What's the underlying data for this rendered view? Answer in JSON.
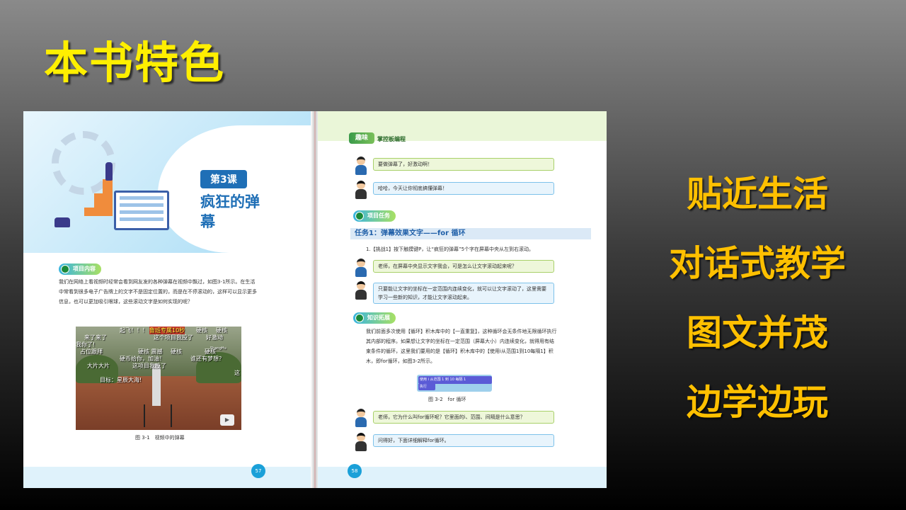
{
  "slide": {
    "title": "本书特色",
    "features": [
      "贴近生活",
      "对话式教学",
      "图文并茂",
      "边学边玩"
    ]
  },
  "left_page": {
    "lesson_badge": "第3课",
    "lesson_title": "疯狂的弹幕",
    "section_tag": "项目内容",
    "paragraph": "我们在网络上看视频时经常会看到网友发的各种弹幕在视频中飘过，如图3-1所示。在生活中常看到很多电子广告牌上的文字不是固定位置的，而是在不停滚动的，这样可以显示更多信息，也可以更加吸引眼球，这些滚动文字是如何实现的呢？",
    "danmaku": [
      "起飞！！！",
      "鲁班专属10秒",
      "硬核",
      "硬核",
      "来了来了",
      "这个项目我投了",
      "好激动",
      "我你了!",
      "占位跟拜",
      "硬核 震撼",
      "硬核",
      "硬核",
      "硬币给你，加油！",
      "谁还有梦想？",
      "大片大片",
      "这项目我投了",
      "目标：星辰大海!",
      "这"
    ],
    "video_watermark": "ShangHu",
    "figure_caption": "图 3-1　视频中的弹幕",
    "page_number": "57"
  },
  "right_page": {
    "header_badge": "趣味",
    "header_text": "掌控板编程",
    "dialog_1": "要做弹幕了，好激动啊！",
    "dialog_2": "哈哈，今天让你彻底搞懂弹幕！",
    "section_tag_1": "项目任务",
    "task_title": "任务1：弹幕效果文字——for 循环",
    "task_step": "1.【挑战1】按下触摸键P，让“疯狂的弹幕”5个字在屏幕中央从左到右滚动。",
    "dialog_3": "老师，在屏幕中央显示文字我会，可是怎么让文字滚动起来呢？",
    "dialog_4": "只要能让文字的坐标在一定范围内连续变化，就可以让文字滚动了，这里需要学习一些新的知识，才能让文字滚动起来。",
    "section_tag_2": "知识拓展",
    "paragraph": "我们前面多次使用【循环】积木库中的【一直重复】，这种循环会无条件地无限循环执行其内部的程序。如果想让文字的坐标在一定范围（屏幕大小）内连续变化，就得用有结束条件的循环，这里我们要用的是【循环】积木库中的【使用i从范围1到10每隔1】积木，即for循环，如图3-2所示。",
    "block_label_1": "使用 i 从范围 1 到 10 每隔 1",
    "block_label_2": "执行",
    "figure_caption": "图 3-2　for 循环",
    "dialog_5": "老师，它为什么叫for循环呢？它里面的i、范围、间隔是什么意思？",
    "dialog_6": "问得好，下面详细解释for循环。",
    "page_number": "58"
  },
  "colors": {
    "title": "#ffef00",
    "features": "#ffc000",
    "accent_blue": "#1f6fb6"
  }
}
